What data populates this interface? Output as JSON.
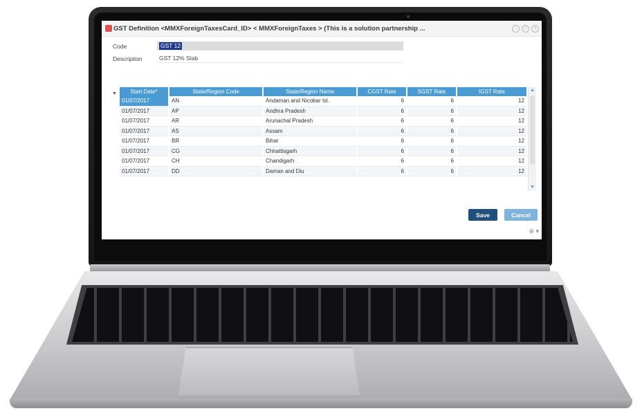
{
  "window": {
    "title": "GST Definition <MMXForeignTaxesCard_ID> < MMXForeignTaxes > (This is a solution partnership ..."
  },
  "form": {
    "code_label": "Code",
    "code_value": "GST 12",
    "description_label": "Description",
    "description_value": "GST 12% Slab"
  },
  "grid": {
    "columns": [
      "Start Date*",
      "State/Region Code",
      "State/Region Name",
      "CGST Rate",
      "SGST Rate",
      "IGST Rate"
    ],
    "rows": [
      [
        "01/07/2017",
        "AN",
        "Andaman and Nicobar Isl.",
        "6",
        "6",
        "12"
      ],
      [
        "01/07/2017",
        "AP",
        "Andhra Pradesh",
        "6",
        "6",
        "12"
      ],
      [
        "01/07/2017",
        "AR",
        "Arunachal Pradesh",
        "6",
        "6",
        "12"
      ],
      [
        "01/07/2017",
        "AS",
        "Assam",
        "6",
        "6",
        "12"
      ],
      [
        "01/07/2017",
        "BR",
        "Bihar",
        "6",
        "6",
        "12"
      ],
      [
        "01/07/2017",
        "CG",
        "Chhattisgarh",
        "6",
        "6",
        "12"
      ],
      [
        "01/07/2017",
        "CH",
        "Chandigarh",
        "6",
        "6",
        "12"
      ],
      [
        "01/07/2017",
        "DD",
        "Daman and Diu",
        "6",
        "6",
        "12"
      ]
    ]
  },
  "actions": {
    "save_label": "Save",
    "cancel_label": "Cancel"
  },
  "icons": {
    "title_buttons": [
      "minimize-icon",
      "maximize-icon",
      "close-icon"
    ]
  },
  "colors": {
    "header_blue": "#4a9bd4",
    "save_button": "#1f4f7a",
    "cancel_button": "#7fb3dc",
    "app_icon": "#d9534f"
  }
}
